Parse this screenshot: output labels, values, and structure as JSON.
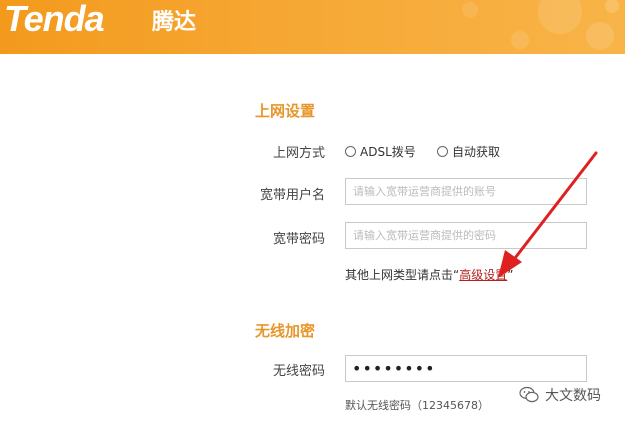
{
  "header": {
    "logo_en": "Tenda",
    "logo_cn": "腾达",
    "background_color": "#f6a733"
  },
  "internet": {
    "section_title": "上网设置",
    "mode_label": "上网方式",
    "mode_options": [
      "ADSL拨号",
      "自动获取"
    ],
    "username_label": "宽带用户名",
    "username_placeholder": "请输入宽带运营商提供的账号",
    "password_label": "宽带密码",
    "password_placeholder": "请输入宽带运营商提供的密码",
    "hint_prefix": "其他上网类型请点击“",
    "hint_link": "高级设置",
    "hint_suffix": "”"
  },
  "wireless": {
    "section_title": "无线加密",
    "password_label": "无线密码",
    "password_value": "••••••••",
    "default_password_note": "默认无线密码（12345678）"
  },
  "watermark": {
    "text": "大文数码",
    "icon": "wechat-icon"
  },
  "annotation": {
    "arrow_color": "#e02020",
    "icon": "red-arrow-icon"
  }
}
